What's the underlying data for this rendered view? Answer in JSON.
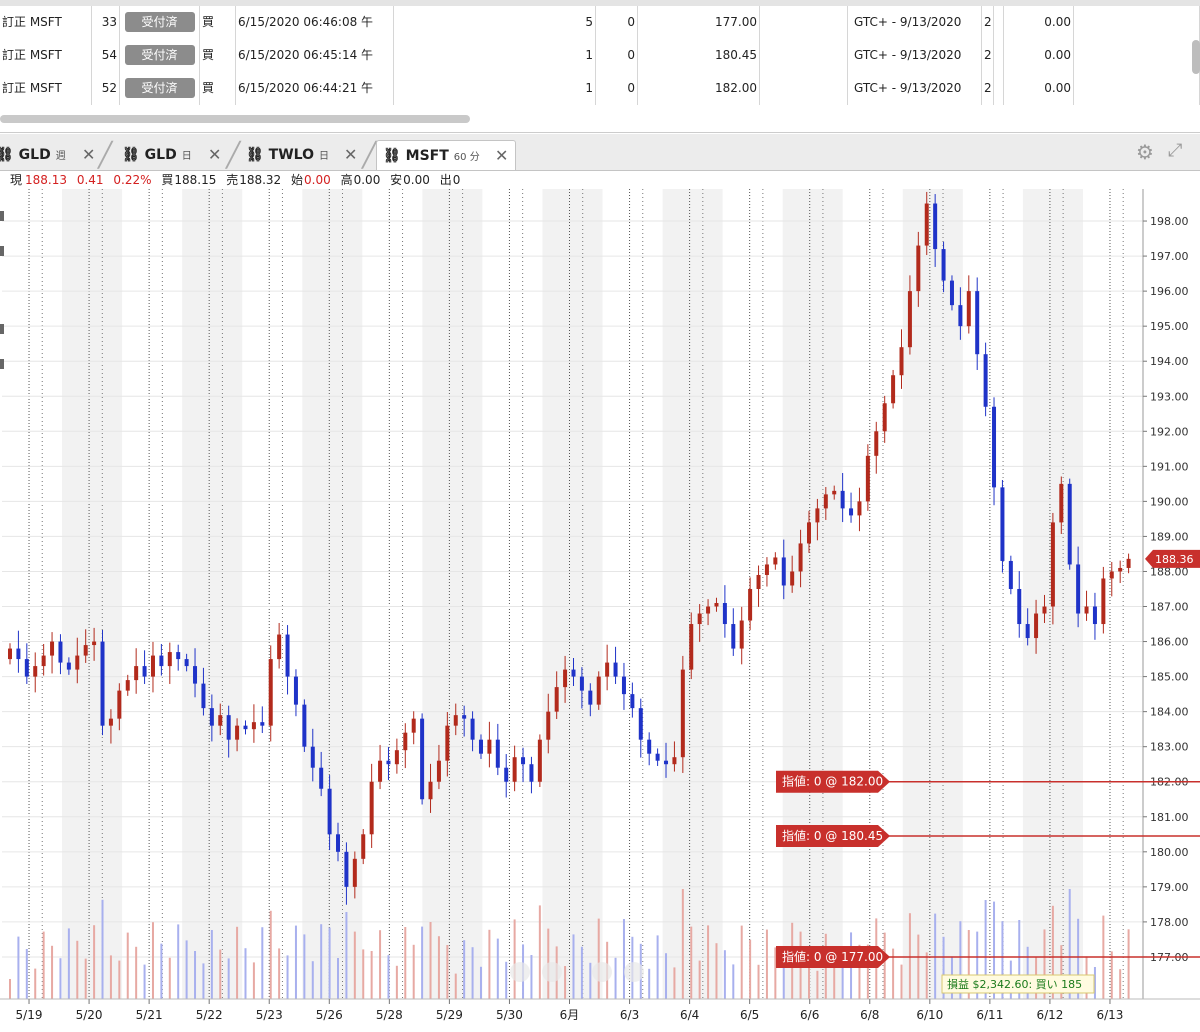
{
  "orders": {
    "rows": [
      {
        "type": "訂正 MSFT",
        "id": "33",
        "status": "受付済",
        "side": "買",
        "time": "6/15/2020 06:46:08 午",
        "qty": "5",
        "filled": "0",
        "price": "177.00",
        "tif": "GTC+ - 9/13/2020",
        "extra": "2",
        "amount": "0.00"
      },
      {
        "type": "訂正 MSFT",
        "id": "54",
        "status": "受付済",
        "side": "買",
        "time": "6/15/2020 06:45:14 午",
        "qty": "1",
        "filled": "0",
        "price": "180.45",
        "tif": "GTC+ - 9/13/2020",
        "extra": "2",
        "amount": "0.00"
      },
      {
        "type": "訂正 MSFT",
        "id": "52",
        "status": "受付済",
        "side": "買",
        "time": "6/15/2020 06:44:21 午",
        "qty": "1",
        "filled": "0",
        "price": "182.00",
        "tif": "GTC+ - 9/13/2020",
        "extra": "2",
        "amount": "0.00"
      }
    ]
  },
  "tabs": [
    {
      "symbol": "GLD",
      "period": "週"
    },
    {
      "symbol": "GLD",
      "period": "日"
    },
    {
      "symbol": "TWLO",
      "period": "日"
    },
    {
      "symbol": "MSFT",
      "period": "60 分",
      "active": true
    }
  ],
  "quote": {
    "last_label": "現",
    "last": "188.13",
    "change": "0.41",
    "change_pct": "0.22%",
    "bid_label": "買",
    "bid": "188.15",
    "ask_label": "売",
    "ask": "188.32",
    "open_label": "始",
    "open": "0.00",
    "high_label": "高",
    "high": "0.00",
    "low_label": "安",
    "low": "0.00",
    "vol_label": "出",
    "vol": "0"
  },
  "colors": {
    "up": "#b22a1c",
    "down": "#1f33c8",
    "order_line": "#c8302c",
    "pl_text": "#1a7a1a"
  },
  "chart_data": {
    "type": "candlestick",
    "ylim": [
      175.8,
      198.8
    ],
    "yticks": [
      "177.00",
      "178.00",
      "179.00",
      "180.00",
      "181.00",
      "182.00",
      "183.00",
      "184.00",
      "185.00",
      "186.00",
      "187.00",
      "188.00",
      "189.00",
      "190.00",
      "191.00",
      "192.00",
      "193.00",
      "194.00",
      "195.00",
      "196.00",
      "197.00",
      "198.00"
    ],
    "x_labels": [
      "5/19",
      "5/20",
      "5/21",
      "5/22",
      "5/23",
      "5/26",
      "5/28",
      "5/29",
      "5/30",
      "6月",
      "6/3",
      "6/4",
      "6/5",
      "6/6",
      "6/8",
      "6/10",
      "6/11",
      "6/12",
      "6/13"
    ],
    "last_price": "188.36",
    "grid": true,
    "series": [
      {
        "values": [
          185.8,
          185.5,
          185.0,
          185.3,
          185.6,
          186.0,
          185.4,
          185.2,
          185.6,
          185.9,
          186.0,
          183.6,
          183.8,
          184.6,
          184.9,
          185.3,
          185.0,
          185.6,
          185.3,
          185.7,
          185.5,
          185.3,
          184.8,
          184.1,
          183.6,
          183.9,
          183.2,
          183.6,
          183.5,
          183.7,
          183.6,
          185.5,
          186.2,
          185.0,
          184.2,
          183.0,
          182.4,
          181.8,
          180.5,
          180.0,
          179.0,
          179.8,
          180.5,
          182.0,
          182.6,
          182.5,
          182.9,
          183.4,
          183.8,
          181.5,
          182.0,
          182.6,
          183.6,
          183.9,
          183.8,
          183.2,
          182.8,
          183.2,
          182.4,
          182.0,
          182.7,
          182.5,
          182.0,
          183.2,
          184.0,
          184.7,
          185.2,
          185.0,
          184.6,
          184.2,
          185.0,
          185.4,
          185.0,
          184.5,
          184.1,
          183.2,
          182.8,
          182.6,
          182.5,
          182.7,
          185.2,
          186.5,
          186.8,
          187.0,
          187.1,
          186.5,
          185.8,
          186.6,
          187.5,
          187.9,
          188.2,
          188.4,
          187.6,
          188.0,
          188.8,
          189.4,
          189.8,
          190.2,
          190.3,
          189.8,
          189.6,
          190.0,
          191.3,
          192.0,
          192.8,
          193.6,
          194.4,
          196.0,
          197.3,
          198.5,
          197.2,
          196.3,
          195.6,
          195.0,
          196.0,
          194.2,
          192.7,
          190.4,
          188.3,
          187.5,
          186.5,
          186.1,
          186.8,
          187.0,
          189.4,
          190.5,
          188.2,
          186.8,
          187.0,
          186.5,
          187.8,
          188.0,
          188.1,
          188.36
        ]
      }
    ],
    "volume_note": "",
    "orders": [
      {
        "label": "指値: 0 @ 182.00",
        "price": 182.0
      },
      {
        "label": "指値: 0 @ 180.45",
        "price": 180.45
      },
      {
        "label": "指値: 0 @ 177.00",
        "price": 177.0
      }
    ],
    "pl_label": "損益 $2,342.60: 買い 185"
  }
}
